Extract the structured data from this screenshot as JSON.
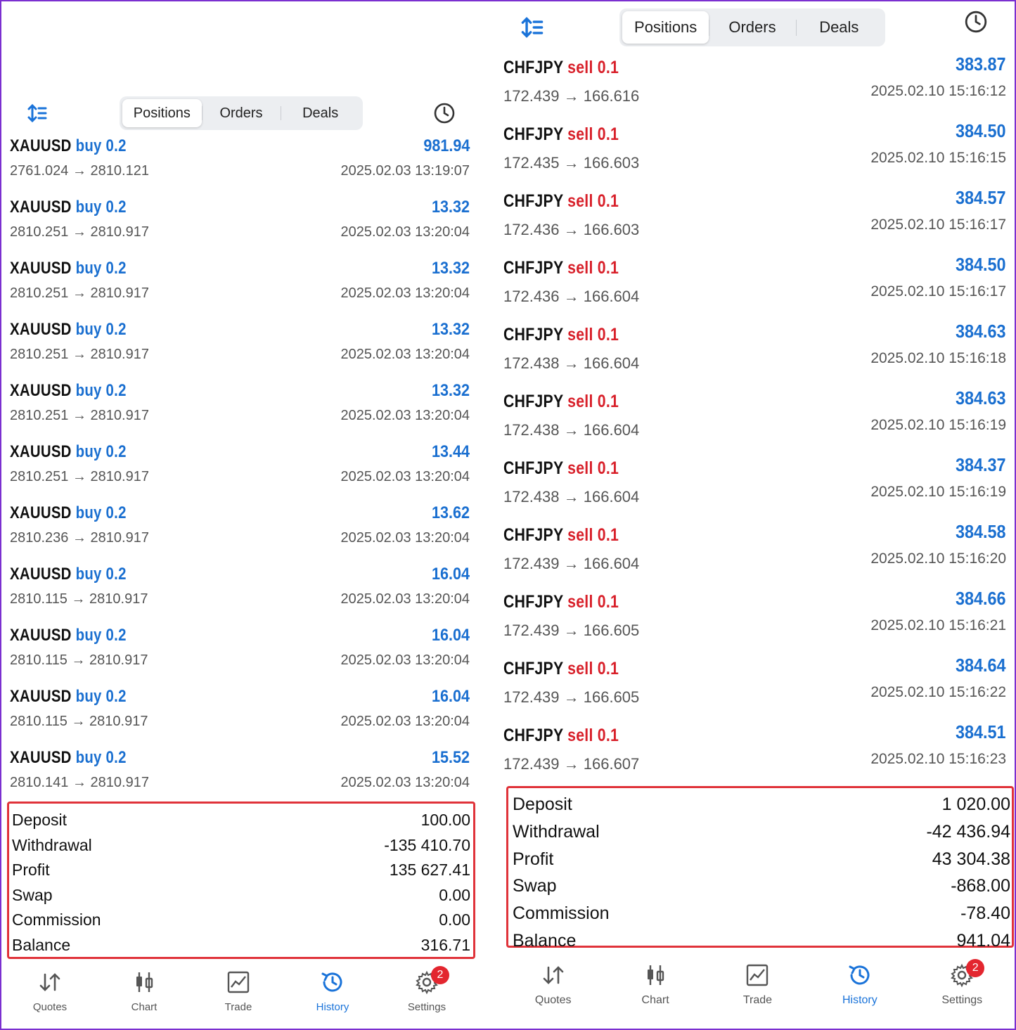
{
  "left": {
    "tabs": [
      "Positions",
      "Orders",
      "Deals"
    ],
    "active_tab": "Positions",
    "deals": [
      {
        "symbol": "XAUUSD",
        "side": "buy 0.2",
        "prices": "2761.024 → 2810.121",
        "profit": "981.94",
        "time": "2025.02.03 13:19:07"
      },
      {
        "symbol": "XAUUSD",
        "side": "buy 0.2",
        "prices": "2810.251 → 2810.917",
        "profit": "13.32",
        "time": "2025.02.03 13:20:04"
      },
      {
        "symbol": "XAUUSD",
        "side": "buy 0.2",
        "prices": "2810.251 → 2810.917",
        "profit": "13.32",
        "time": "2025.02.03 13:20:04"
      },
      {
        "symbol": "XAUUSD",
        "side": "buy 0.2",
        "prices": "2810.251 → 2810.917",
        "profit": "13.32",
        "time": "2025.02.03 13:20:04"
      },
      {
        "symbol": "XAUUSD",
        "side": "buy 0.2",
        "prices": "2810.251 → 2810.917",
        "profit": "13.32",
        "time": "2025.02.03 13:20:04"
      },
      {
        "symbol": "XAUUSD",
        "side": "buy 0.2",
        "prices": "2810.251 → 2810.917",
        "profit": "13.44",
        "time": "2025.02.03 13:20:04"
      },
      {
        "symbol": "XAUUSD",
        "side": "buy 0.2",
        "prices": "2810.236 → 2810.917",
        "profit": "13.62",
        "time": "2025.02.03 13:20:04"
      },
      {
        "symbol": "XAUUSD",
        "side": "buy 0.2",
        "prices": "2810.115 → 2810.917",
        "profit": "16.04",
        "time": "2025.02.03 13:20:04"
      },
      {
        "symbol": "XAUUSD",
        "side": "buy 0.2",
        "prices": "2810.115 → 2810.917",
        "profit": "16.04",
        "time": "2025.02.03 13:20:04"
      },
      {
        "symbol": "XAUUSD",
        "side": "buy 0.2",
        "prices": "2810.115 → 2810.917",
        "profit": "16.04",
        "time": "2025.02.03 13:20:04"
      },
      {
        "symbol": "XAUUSD",
        "side": "buy 0.2",
        "prices": "2810.141 → 2810.917",
        "profit": "15.52",
        "time": "2025.02.03 13:20:04"
      }
    ],
    "summary": [
      {
        "label": "Deposit",
        "value": "100.00"
      },
      {
        "label": "Withdrawal",
        "value": "-135 410.70"
      },
      {
        "label": "Profit",
        "value": "135 627.41"
      },
      {
        "label": "Swap",
        "value": "0.00"
      },
      {
        "label": "Commission",
        "value": "0.00"
      },
      {
        "label": "Balance",
        "value": "316.71"
      }
    ],
    "nav": [
      {
        "label": "Quotes"
      },
      {
        "label": "Chart"
      },
      {
        "label": "Trade"
      },
      {
        "label": "History"
      },
      {
        "label": "Settings",
        "badge": "2"
      }
    ]
  },
  "right": {
    "tabs": [
      "Positions",
      "Orders",
      "Deals"
    ],
    "active_tab": "Positions",
    "deals": [
      {
        "symbol": "CHFJPY",
        "side": "sell 0.1",
        "prices": "172.439 → 166.616",
        "profit": "383.87",
        "time": "2025.02.10 15:16:12"
      },
      {
        "symbol": "CHFJPY",
        "side": "sell 0.1",
        "prices": "172.435 → 166.603",
        "profit": "384.50",
        "time": "2025.02.10 15:16:15"
      },
      {
        "symbol": "CHFJPY",
        "side": "sell 0.1",
        "prices": "172.436 → 166.603",
        "profit": "384.57",
        "time": "2025.02.10 15:16:17"
      },
      {
        "symbol": "CHFJPY",
        "side": "sell 0.1",
        "prices": "172.436 → 166.604",
        "profit": "384.50",
        "time": "2025.02.10 15:16:17"
      },
      {
        "symbol": "CHFJPY",
        "side": "sell 0.1",
        "prices": "172.438 → 166.604",
        "profit": "384.63",
        "time": "2025.02.10 15:16:18"
      },
      {
        "symbol": "CHFJPY",
        "side": "sell 0.1",
        "prices": "172.438 → 166.604",
        "profit": "384.63",
        "time": "2025.02.10 15:16:19"
      },
      {
        "symbol": "CHFJPY",
        "side": "sell 0.1",
        "prices": "172.438 → 166.604",
        "profit": "384.37",
        "time": "2025.02.10 15:16:19"
      },
      {
        "symbol": "CHFJPY",
        "side": "sell 0.1",
        "prices": "172.439 → 166.604",
        "profit": "384.58",
        "time": "2025.02.10 15:16:20"
      },
      {
        "symbol": "CHFJPY",
        "side": "sell 0.1",
        "prices": "172.439 → 166.605",
        "profit": "384.66",
        "time": "2025.02.10 15:16:21"
      },
      {
        "symbol": "CHFJPY",
        "side": "sell 0.1",
        "prices": "172.439 → 166.605",
        "profit": "384.64",
        "time": "2025.02.10 15:16:22"
      },
      {
        "symbol": "CHFJPY",
        "side": "sell 0.1",
        "prices": "172.439 → 166.607",
        "profit": "384.51",
        "time": "2025.02.10 15:16:23"
      }
    ],
    "summary": [
      {
        "label": "Deposit",
        "value": "1 020.00"
      },
      {
        "label": "Withdrawal",
        "value": "-42 436.94"
      },
      {
        "label": "Profit",
        "value": "43 304.38"
      },
      {
        "label": "Swap",
        "value": "-868.00"
      },
      {
        "label": "Commission",
        "value": "-78.40"
      },
      {
        "label": "Balance",
        "value": "941.04"
      }
    ],
    "nav": [
      {
        "label": "Quotes"
      },
      {
        "label": "Chart"
      },
      {
        "label": "Trade"
      },
      {
        "label": "History"
      },
      {
        "label": "Settings",
        "badge": "2"
      }
    ]
  },
  "colors": {
    "buy": "#1a6fd0",
    "sell": "#d8202a",
    "profit": "#1a6fd0",
    "accent": "#1a73d9",
    "highlight_border": "#e0333a",
    "badge": "#e3262f"
  },
  "icons": {
    "sort": "sort-icon",
    "clock": "clock-icon",
    "quotes": "quotes-icon",
    "chart": "candlestick-chart-icon",
    "trade": "trade-chart-icon",
    "history": "history-icon",
    "settings": "gear-icon"
  }
}
